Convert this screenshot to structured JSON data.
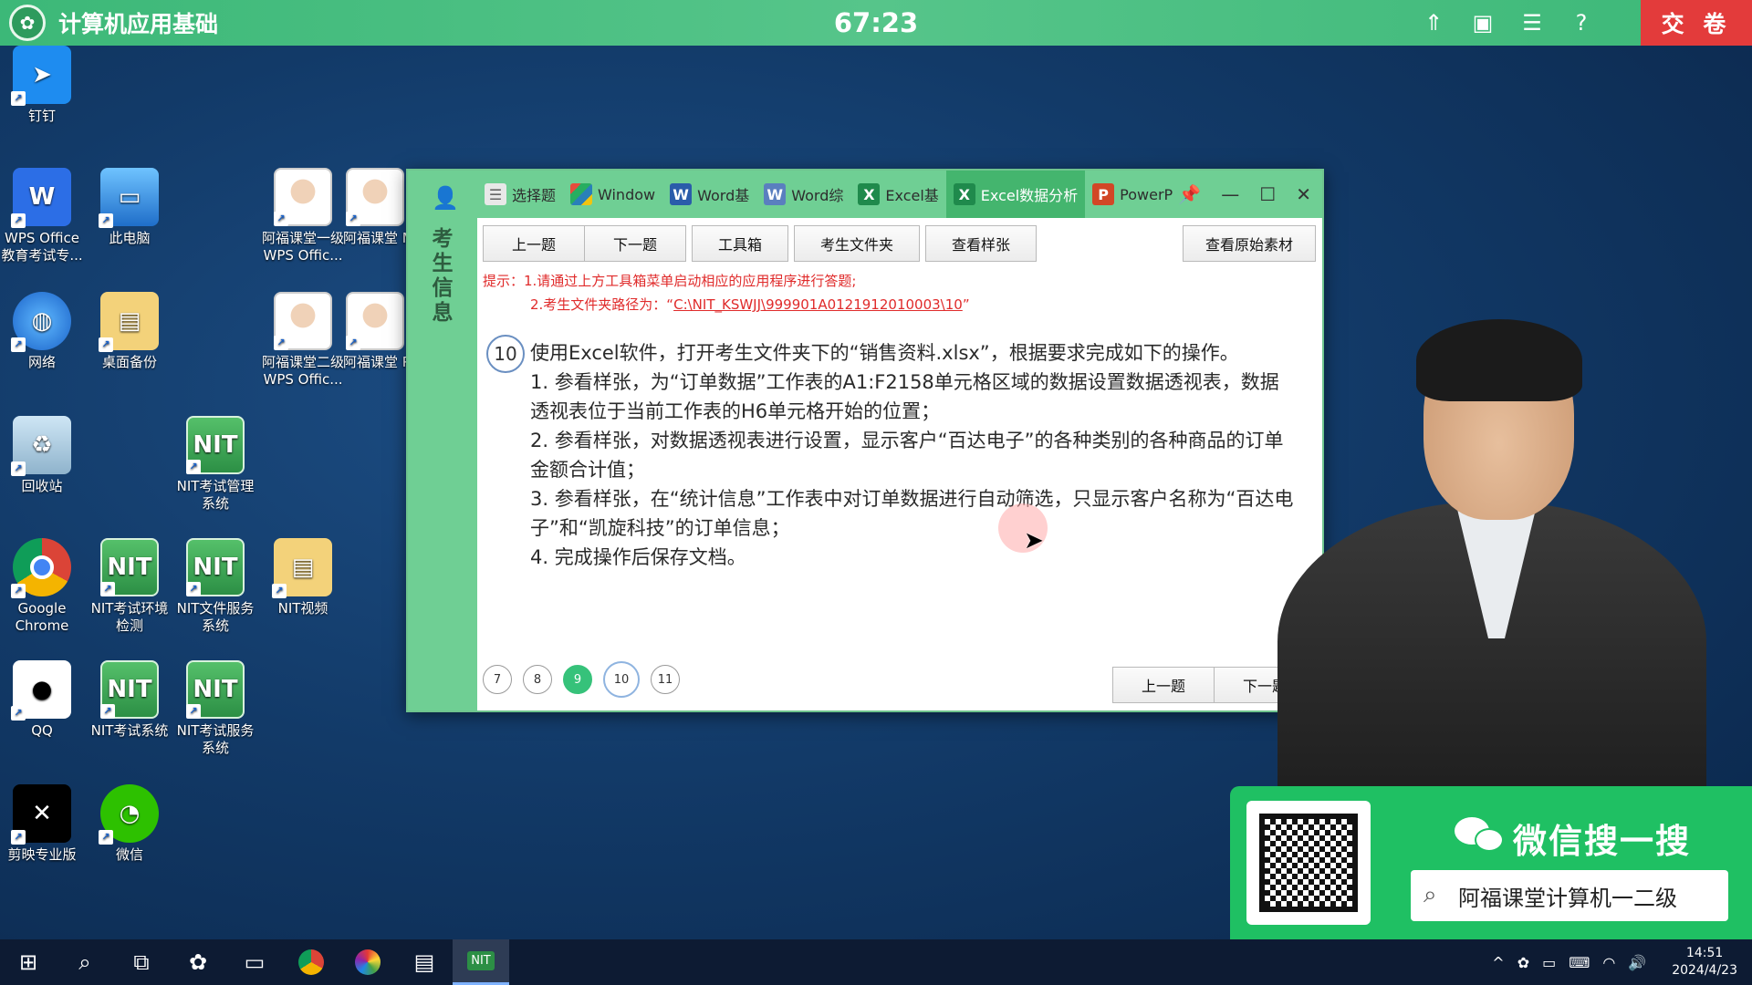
{
  "exam_bar": {
    "title": "计算机应用基础",
    "timer": "67:23",
    "submit_label": "交 卷",
    "icons": [
      "collapse-icon",
      "window-icon",
      "list-icon",
      "help-icon"
    ]
  },
  "desktop_icons": [
    {
      "label": "钉钉"
    },
    {
      "label": "WPS Office 教育考试专..."
    },
    {
      "label": "此电脑"
    },
    {
      "label": "阿福课堂一级 WPS Offic..."
    },
    {
      "label": "阿福课堂 MS Offic"
    },
    {
      "label": "网络"
    },
    {
      "label": "桌面备份"
    },
    {
      "label": "阿福课堂二级 WPS Offic..."
    },
    {
      "label": "阿福课堂 Python是"
    },
    {
      "label": "回收站"
    },
    {
      "label": "NIT考试管理系统"
    },
    {
      "label": "Google Chrome"
    },
    {
      "label": "NIT考试环境检测"
    },
    {
      "label": "NIT文件服务系统"
    },
    {
      "label": "NIT视频"
    },
    {
      "label": "QQ"
    },
    {
      "label": "NIT考试系统"
    },
    {
      "label": "NIT考试服务系统"
    },
    {
      "label": "剪映专业版"
    },
    {
      "label": "微信"
    }
  ],
  "exam_window": {
    "side_label": "考生信息",
    "tabs": [
      {
        "label": "选择题"
      },
      {
        "label": "Window"
      },
      {
        "label": "Word基"
      },
      {
        "label": "Word综"
      },
      {
        "label": "Excel基"
      },
      {
        "label": "Excel数据分析"
      },
      {
        "label": "PowerP"
      }
    ],
    "toolbar": {
      "prev": "上一题",
      "next": "下一题",
      "tools": "工具箱",
      "folder": "考生文件夹",
      "sample": "查看样张",
      "original": "查看原始素材"
    },
    "hints": {
      "line1": "提示：1.请通过上方工具箱菜单启动相应的应用程序进行答题;",
      "line2_prefix": "2.考生文件夹路径为：“",
      "path": "C:\\NIT_KSWJJ\\999901A0121912010003\\10",
      "line2_suffix": "”"
    },
    "question": {
      "number": "10",
      "lines": [
        "使用Excel软件，打开考生文件夹下的“销售资料.xlsx”，根据要求完成如下的操作。",
        "1. 参看样张，为“订单数据”工作表的A1:F2158单元格区域的数据设置数据透视表，数据透视表位于当前工作表的H6单元格开始的位置；",
        "2. 参看样张，对数据透视表进行设置，显示客户“百达电子”的各种类别的各种商品的订单金额合计值；",
        "3. 参看样张，在“统计信息”工作表中对订单数据进行自动筛选，只显示客户名称为“百达电子”和“凯旋科技”的订单信息；",
        "4. 完成操作后保存文档。"
      ]
    },
    "nav_dots": [
      "7",
      "8",
      "9",
      "10",
      "11"
    ],
    "bottom": {
      "prev": "上一题",
      "next": "下一题"
    }
  },
  "wechat_banner": {
    "title": "微信搜一搜",
    "search_text": "阿福课堂计算机一二级"
  },
  "taskbar": {
    "time": "14:51",
    "date": "2024/4/23"
  },
  "colors": {
    "accent_green": "#3cb878",
    "submit_red": "#e33b3b",
    "hint_red": "#e02b2b",
    "wechat_green": "#1fc063"
  }
}
